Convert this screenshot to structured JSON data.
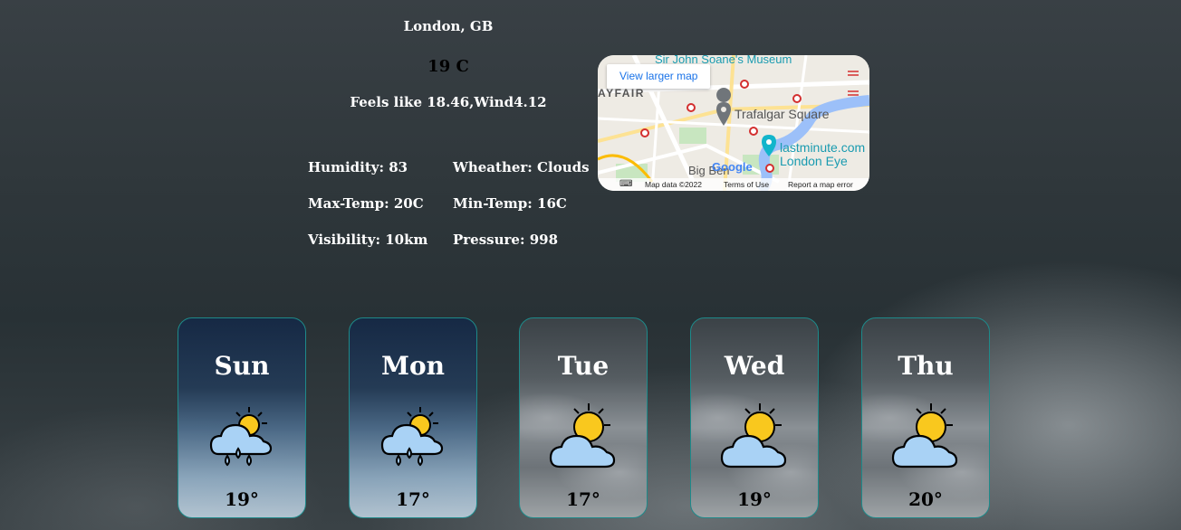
{
  "current": {
    "city": "London, GB",
    "temp": "19 C",
    "feels": "Feels like 18.46,Wind4.12"
  },
  "stats": {
    "humidity": "Humidity: 83",
    "weather": "Wheather: Clouds",
    "max_temp": "Max-Temp: 20C",
    "min_temp": "Min-Temp: 16C",
    "visibility": "Visibility: 10km",
    "pressure": "Pressure: 998"
  },
  "map": {
    "view_larger": "View larger map",
    "labels": {
      "museum": "Sir John Soane's Museum",
      "mayfair": "AYFAIR",
      "trafalgar": "Trafalgar Square",
      "lastminute": "lastminute.com",
      "london_eye": "London Eye",
      "big_ben": "Big Ben",
      "google": "Google"
    },
    "footer": {
      "map_data": "Map data ©2022",
      "terms": "Terms of Use",
      "report": "Report a map error"
    }
  },
  "forecast": [
    {
      "day": "Sun",
      "temp": "19°",
      "condition": "rain",
      "icon": "sun-cloud-rain-icon"
    },
    {
      "day": "Mon",
      "temp": "17°",
      "condition": "rain",
      "icon": "sun-cloud-rain-icon"
    },
    {
      "day": "Tue",
      "temp": "17°",
      "condition": "clouds",
      "icon": "sun-cloud-icon"
    },
    {
      "day": "Wed",
      "temp": "19°",
      "condition": "clouds",
      "icon": "sun-cloud-icon"
    },
    {
      "day": "Thu",
      "temp": "20°",
      "condition": "clouds",
      "icon": "sun-cloud-icon"
    }
  ]
}
